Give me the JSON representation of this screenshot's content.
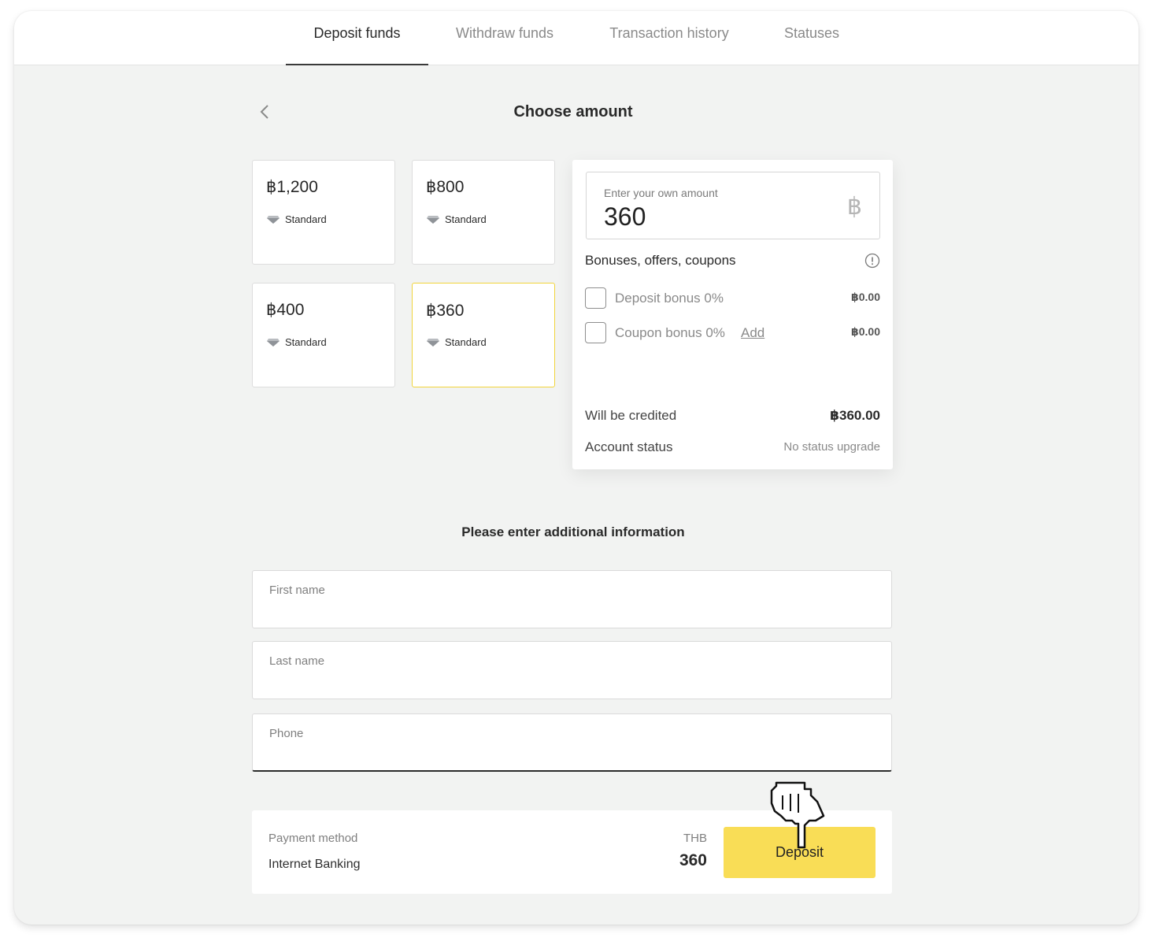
{
  "tabs": [
    {
      "label": "Deposit funds",
      "active": true
    },
    {
      "label": "Withdraw funds",
      "active": false
    },
    {
      "label": "Transaction history",
      "active": false
    },
    {
      "label": "Statuses",
      "active": false
    }
  ],
  "page_title": "Choose amount",
  "amount_cards": [
    {
      "value": "฿1,200",
      "tier": "Standard",
      "selected": false
    },
    {
      "value": "฿800",
      "tier": "Standard",
      "selected": false
    },
    {
      "value": "฿400",
      "tier": "Standard",
      "selected": false
    },
    {
      "value": "฿360",
      "tier": "Standard",
      "selected": true
    }
  ],
  "own_amount": {
    "label": "Enter your own amount",
    "value": "360",
    "currency_symbol": "฿"
  },
  "bonuses": {
    "title": "Bonuses, offers, coupons",
    "deposit_bonus": {
      "label": "Deposit bonus 0%",
      "value": "฿0.00",
      "checked": false
    },
    "coupon_bonus": {
      "label": "Coupon bonus 0%",
      "add_label": "Add",
      "value": "฿0.00",
      "checked": false
    }
  },
  "summary": {
    "credited_label": "Will be credited",
    "credited_value": "฿360.00",
    "status_label": "Account status",
    "status_value": "No status upgrade"
  },
  "additional_info_title": "Please enter additional information",
  "fields": {
    "first_name": {
      "label": "First name",
      "value": ""
    },
    "last_name": {
      "label": "Last name",
      "value": ""
    },
    "phone": {
      "label": "Phone",
      "value": ""
    }
  },
  "payment": {
    "method_label": "Payment method",
    "method_value": "Internet Banking",
    "currency": "THB",
    "amount": "360",
    "deposit_button": "Deposit"
  },
  "colors": {
    "accent_yellow": "#f9dd56",
    "selected_border": "#f1d43b",
    "background": "#f2f3f2"
  },
  "icons": {
    "back": "chevron-left-icon",
    "tier": "diamond-icon",
    "info": "info-icon",
    "cursor": "hand-pointer-icon"
  }
}
